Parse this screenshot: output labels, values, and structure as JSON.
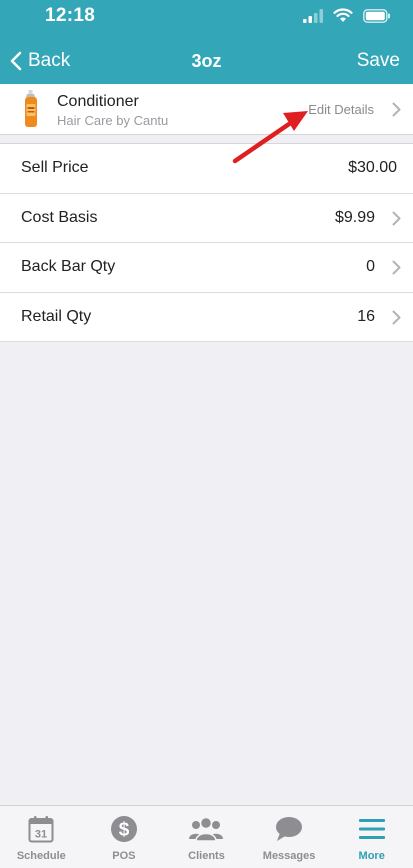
{
  "status_bar": {
    "time": "12:18"
  },
  "nav": {
    "back_label": "Back",
    "title": "3oz",
    "save_label": "Save"
  },
  "product": {
    "name": "Conditioner",
    "brand": "Hair Care by Cantu",
    "edit_label": "Edit Details",
    "icon": "shampoo-bottle-icon"
  },
  "rows": [
    {
      "label": "Sell Price",
      "value": "$30.00",
      "has_chevron": false
    },
    {
      "label": "Cost Basis",
      "value": "$9.99",
      "has_chevron": true
    },
    {
      "label": "Back Bar Qty",
      "value": "0",
      "has_chevron": true
    },
    {
      "label": "Retail Qty",
      "value": "16",
      "has_chevron": true
    }
  ],
  "tabbar": {
    "items": [
      {
        "label": "Schedule",
        "icon": "calendar-icon",
        "badge": "31",
        "active": false
      },
      {
        "label": "POS",
        "icon": "dollar-icon",
        "active": false
      },
      {
        "label": "Clients",
        "icon": "clients-icon",
        "active": false
      },
      {
        "label": "Messages",
        "icon": "chat-bubble-icon",
        "active": false
      },
      {
        "label": "More",
        "icon": "menu-icon",
        "active": true
      }
    ]
  },
  "colors": {
    "brand": "#33a6b8",
    "active_tab": "#2f9fb3",
    "annotation": "#e02020",
    "background": "#efeff4"
  }
}
